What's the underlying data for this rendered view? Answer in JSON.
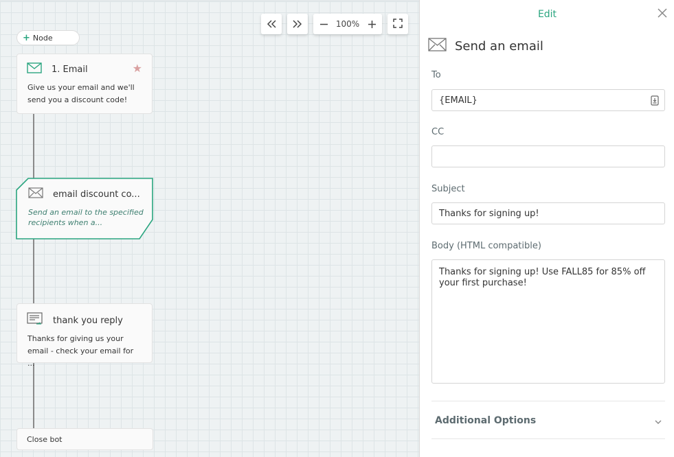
{
  "canvas": {
    "add_node_label": "Node",
    "nodes": [
      {
        "title": "1. Email",
        "body": "Give us your email and we'll send you a discount code!"
      },
      {
        "title": "email discount co...",
        "body": "Send an email to the specified recipients when a..."
      },
      {
        "title": "thank you reply",
        "body": "Thanks for giving us your email - check your email for ..."
      }
    ],
    "close_bot_label": "Close bot",
    "accent_color": "#2aa57f"
  },
  "toolbar": {
    "zoom_level": "100%"
  },
  "panel": {
    "header": "Edit",
    "title": "Send an email",
    "to": {
      "label": "To",
      "value": "{EMAIL}"
    },
    "cc": {
      "label": "CC",
      "value": ""
    },
    "subject": {
      "label": "Subject",
      "value": "Thanks for signing up!"
    },
    "body": {
      "label": "Body (HTML compatible)",
      "value": "Thanks for signing up! Use FALL85 for 85% off your first purchase!"
    },
    "additional_options": "Additional Options"
  }
}
